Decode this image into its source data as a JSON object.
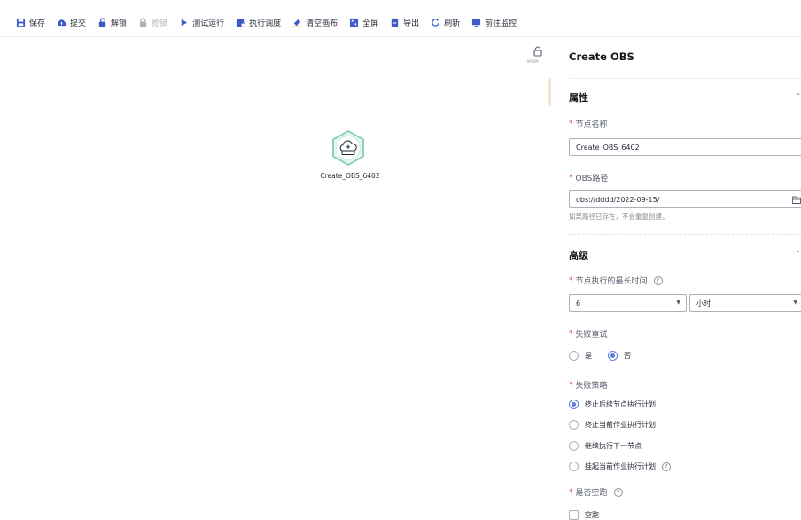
{
  "toolbar": {
    "items": [
      {
        "label": "保存",
        "icon": "save-icon"
      },
      {
        "label": "提交",
        "icon": "upload-cloud-icon"
      },
      {
        "label": "解锁",
        "icon": "unlock-icon"
      },
      {
        "label": "抢锁",
        "icon": "lock-icon"
      },
      {
        "label": "测试运行",
        "icon": "play-icon"
      },
      {
        "label": "执行调度",
        "icon": "schedule-icon"
      },
      {
        "label": "清空画布",
        "icon": "eraser-icon"
      },
      {
        "label": "全屏",
        "icon": "fullscreen-icon"
      },
      {
        "label": "导出",
        "icon": "export-icon"
      },
      {
        "label": "刷新",
        "icon": "refresh-icon"
      },
      {
        "label": "前往监控",
        "icon": "monitor-icon"
      }
    ]
  },
  "canvas": {
    "node_label": "Create_OBS_6402",
    "lock_button_text": "锁定 画布"
  },
  "panel": {
    "title": "Create OBS",
    "properties": {
      "section_title": "属性",
      "node_name_label": "节点名称",
      "node_name_value": "Create_OBS_6402",
      "obs_path_label": "OBS路径",
      "obs_path_value": "obs://dddd/2022-09-15/",
      "obs_path_hint": "如果路径已存在，不会重复创建。"
    },
    "advanced": {
      "section_title": "高级",
      "max_time_label": "节点执行的最长时间",
      "max_time_value": "6",
      "max_time_unit": "小时",
      "retry_label": "失败重试",
      "retry_options": [
        "是",
        "否"
      ],
      "retry_selected": "否",
      "policy_label": "失败策略",
      "policy_options": [
        "终止后续节点执行计划",
        "终止当前作业执行计划",
        "继续执行下一节点",
        "挂起当前作业执行计划"
      ],
      "policy_selected": "终止后续节点执行计划",
      "dry_run_label": "是否空跑",
      "dry_run_checkbox": "空跑"
    }
  },
  "colors": {
    "accent": "#5e7ce0",
    "required": "#e54545",
    "node_ring": "#8fd3b5"
  }
}
